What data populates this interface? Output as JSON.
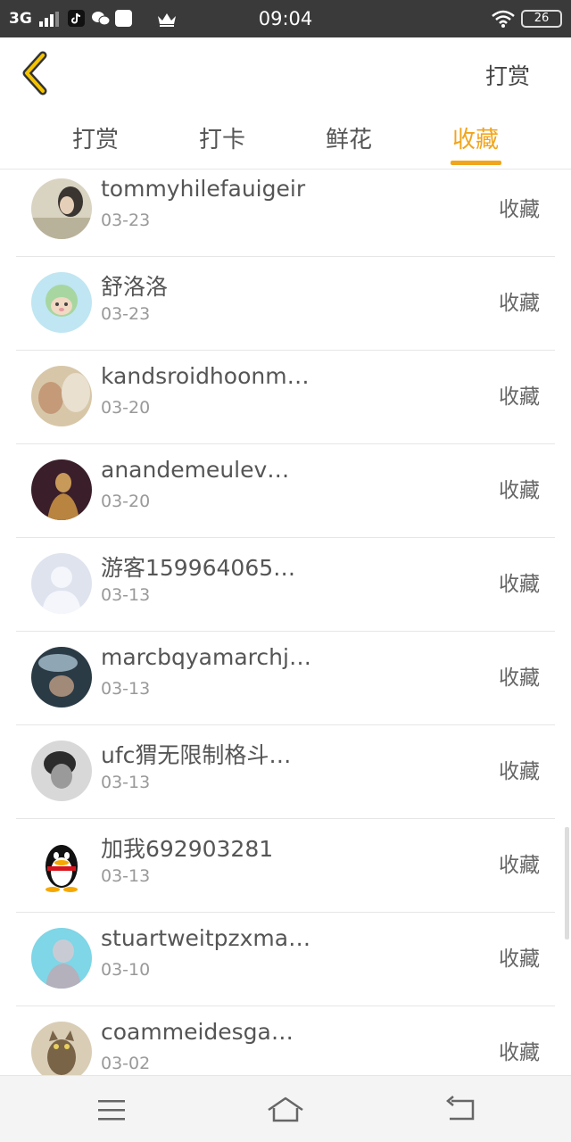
{
  "status_bar": {
    "network": "3G",
    "time": "09:04",
    "battery": "26",
    "icons": [
      "signal-icon",
      "tiktok-icon",
      "wechat-icon",
      "square-icon",
      "crown-icon",
      "wifi-icon",
      "battery-icon"
    ]
  },
  "header": {
    "back_icon": "chevron-left-icon",
    "action_label": "打赏"
  },
  "tabs": [
    {
      "label": "打赏",
      "active": false
    },
    {
      "label": "打卡",
      "active": false
    },
    {
      "label": "鲜花",
      "active": false
    },
    {
      "label": "收藏",
      "active": true
    }
  ],
  "accent_color": "#f1a51d",
  "list": [
    {
      "name": "tommyhilefauigeir",
      "date": "03-23",
      "action": "收藏"
    },
    {
      "name": "舒洛洛",
      "date": "03-23",
      "action": "收藏"
    },
    {
      "name": "kandsroidhoonm…",
      "date": "03-20",
      "action": "收藏"
    },
    {
      "name": "anandemeulev…",
      "date": "03-20",
      "action": "收藏"
    },
    {
      "name": "游客159964065…",
      "date": "03-13",
      "action": "收藏"
    },
    {
      "name": "marcbqyamarchj…",
      "date": "03-13",
      "action": "收藏"
    },
    {
      "name": "ufc猬无限制格斗…",
      "date": "03-13",
      "action": "收藏"
    },
    {
      "name": "加我692903281",
      "date": "03-13",
      "action": "收藏"
    },
    {
      "name": "stuartweitpzxma…",
      "date": "03-10",
      "action": "收藏"
    },
    {
      "name": "coammeidesga…",
      "date": "03-02",
      "action": "收藏"
    }
  ],
  "nav_bar": {
    "icons": [
      "menu-icon",
      "home-icon",
      "back-icon"
    ]
  }
}
